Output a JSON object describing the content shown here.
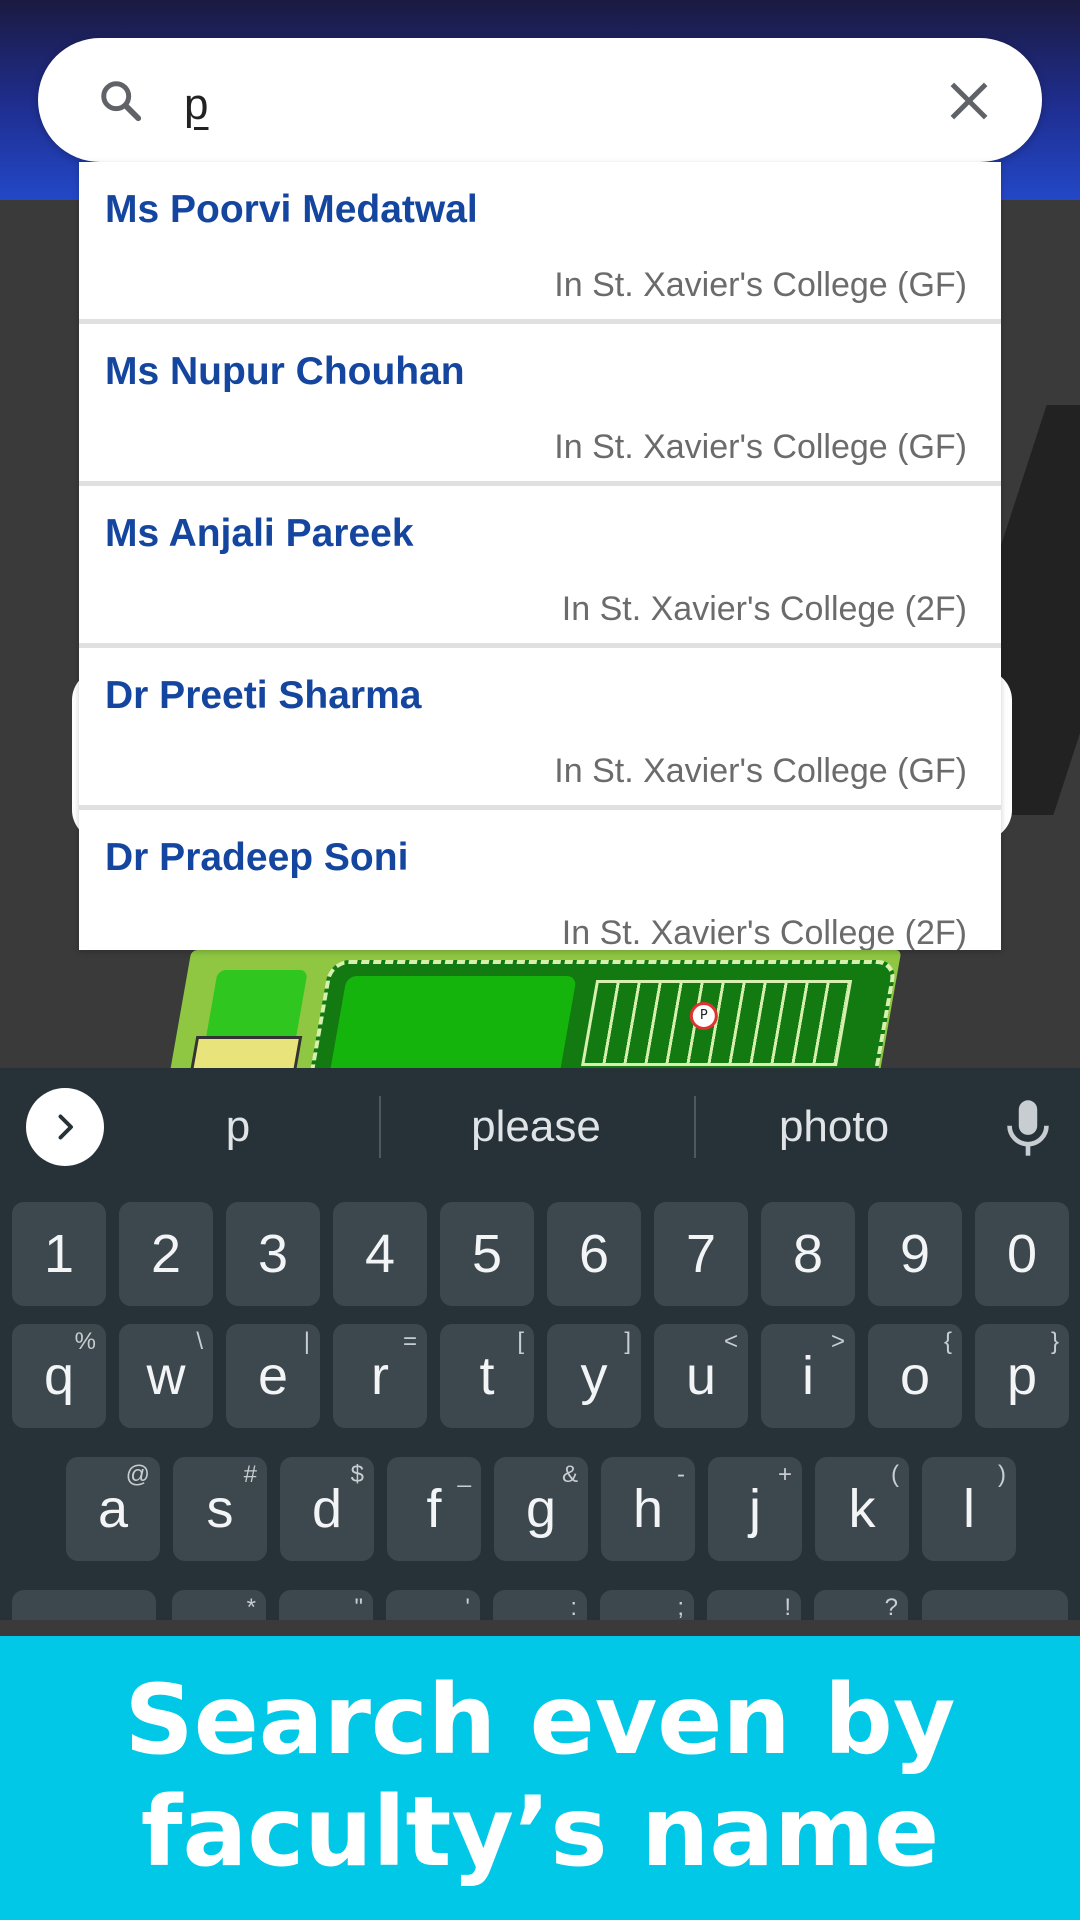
{
  "search": {
    "query": "p"
  },
  "results": [
    {
      "name": "Ms Poorvi Medatwal",
      "location": "In St. Xavier's College (GF)"
    },
    {
      "name": "Ms Nupur Chouhan",
      "location": "In St. Xavier's College (GF)"
    },
    {
      "name": "Ms Anjali Pareek",
      "location": "In St. Xavier's College (2F)"
    },
    {
      "name": "Dr Preeti Sharma",
      "location": "In St. Xavier's College (GF)"
    },
    {
      "name": "Dr Pradeep Soni",
      "location": "In St. Xavier's College (2F)"
    }
  ],
  "map": {
    "parking_label": "P"
  },
  "keyboard": {
    "suggestions": [
      "p",
      "please",
      "photo"
    ],
    "number_row": [
      "1",
      "2",
      "3",
      "4",
      "5",
      "6",
      "7",
      "8",
      "9",
      "0"
    ],
    "row_q": [
      {
        "key": "q",
        "alt": "%"
      },
      {
        "key": "w",
        "alt": "\\"
      },
      {
        "key": "e",
        "alt": "|"
      },
      {
        "key": "r",
        "alt": "="
      },
      {
        "key": "t",
        "alt": "["
      },
      {
        "key": "y",
        "alt": "]"
      },
      {
        "key": "u",
        "alt": "<"
      },
      {
        "key": "i",
        "alt": ">"
      },
      {
        "key": "o",
        "alt": "{"
      },
      {
        "key": "p",
        "alt": "}"
      }
    ],
    "row_a": [
      {
        "key": "a",
        "alt": "@"
      },
      {
        "key": "s",
        "alt": "#"
      },
      {
        "key": "d",
        "alt": "$"
      },
      {
        "key": "f",
        "alt": "_"
      },
      {
        "key": "g",
        "alt": "&"
      },
      {
        "key": "h",
        "alt": "-"
      },
      {
        "key": "j",
        "alt": "+"
      },
      {
        "key": "k",
        "alt": "("
      },
      {
        "key": "l",
        "alt": ")"
      }
    ],
    "row_z_alts": [
      "*",
      "\"",
      "'",
      ":",
      ";",
      "!",
      "?"
    ]
  },
  "banner": {
    "line1": "Search even by",
    "line2": "faculty’s name",
    "color": "#00c8e6"
  }
}
